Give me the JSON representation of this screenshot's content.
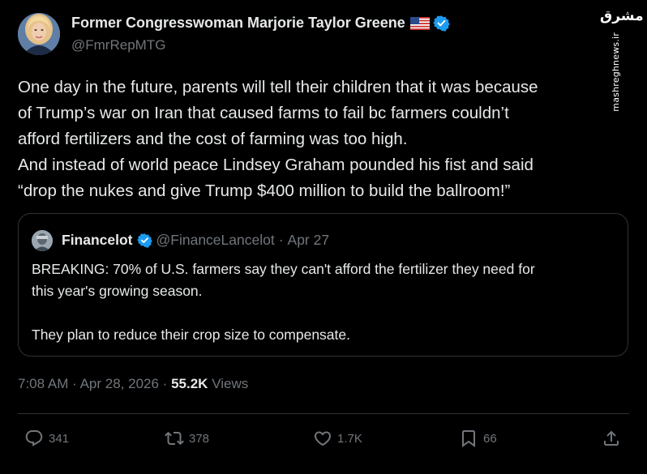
{
  "author": {
    "name": "Former Congresswoman Marjorie Taylor Greene",
    "handle": "@FmrRepMTG"
  },
  "watermark": {
    "logo": "مشرق",
    "url": "mashreghnews.ir"
  },
  "tweet": {
    "lines": [
      "One day in the future, parents will tell their children that it was because",
      "of Trump’s war on Iran that caused farms to fail bc farmers couldn’t",
      "afford fertilizers and the cost of farming was too high.",
      "And instead of world peace Lindsey Graham pounded his fist and said",
      "“drop the nukes and give Trump $400 million to build the ballroom!”"
    ]
  },
  "quote": {
    "name": "Financelot",
    "handle": "@FinanceLancelot",
    "separator": "·",
    "date": "Apr 27",
    "lines": [
      "BREAKING: 70% of U.S. farmers say they can't afford the fertilizer they need for",
      "this year's growing season."
    ],
    "line2": "They plan to reduce their crop size to compensate."
  },
  "meta": {
    "time": "7:08 AM",
    "separator": "·",
    "date": "Apr 28, 2026",
    "separator2": "·",
    "views_count": "55.2K",
    "views_label": "Views"
  },
  "actions": {
    "replies": "341",
    "reposts": "378",
    "likes": "1.7K",
    "bookmarks": "66"
  },
  "colors": {
    "background": "#000000",
    "text": "#e7e9ea",
    "muted": "#71767b",
    "verified": "#1d9bf0",
    "border": "#2f3336"
  },
  "icons": [
    "verified-badge-icon",
    "us-flag-icon",
    "reply-icon",
    "repost-icon",
    "like-icon",
    "bookmark-icon",
    "share-icon"
  ]
}
